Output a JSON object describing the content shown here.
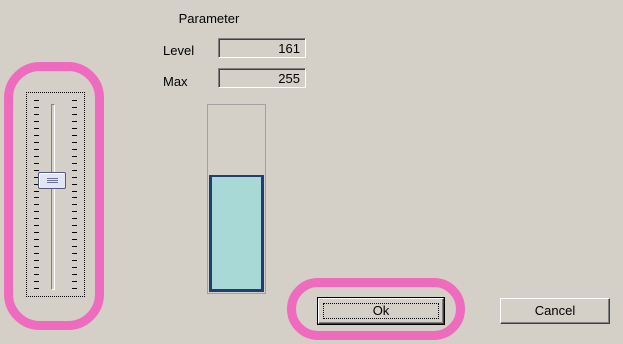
{
  "parameter": {
    "title": "Parameter",
    "level_label": "Level",
    "level_value": "161",
    "max_label": "Max",
    "max_value": "255"
  },
  "slider": {
    "value": 161,
    "max": 255
  },
  "meter": {
    "value": 161,
    "max": 255
  },
  "buttons": {
    "ok_label": "Ok",
    "cancel_label": "Cancel"
  },
  "colors": {
    "dialog_bg": "#d4d0c8",
    "meter_fill": "#a9d9d6",
    "meter_border": "#1f3f72",
    "highlight": "#ee6bbe"
  }
}
